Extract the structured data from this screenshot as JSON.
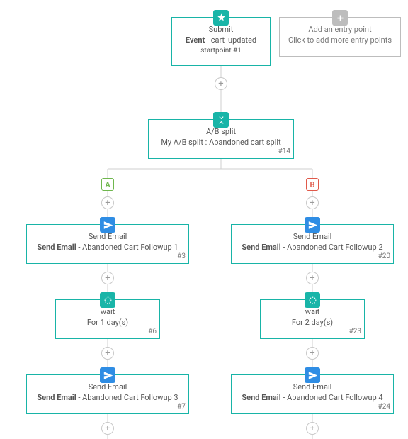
{
  "entry": {
    "title": "Submit",
    "sub_bold": "Event",
    "sub_rest": " - cart_updated",
    "startpoint": "startpoint #1"
  },
  "entry_add": {
    "title": "Add an entry point",
    "sub": "Click to add more entry points"
  },
  "ab_split": {
    "title": "A/B split",
    "sub": "My A/B split : Abandoned cart split",
    "id": "#14"
  },
  "branch_a_label": "A",
  "branch_b_label": "B",
  "a_email1": {
    "title": "Send Email",
    "sub_bold": "Send Email",
    "sub_rest": " - Abandoned Cart Followup 1",
    "id": "#3"
  },
  "a_wait": {
    "title": "wait",
    "sub": "For 1 day(s)",
    "id": "#6"
  },
  "a_email2": {
    "title": "Send Email",
    "sub_bold": "Send Email",
    "sub_rest": " - Abandoned Cart Followup 3",
    "id": "#7"
  },
  "b_email1": {
    "title": "Send Email",
    "sub_bold": "Send Email",
    "sub_rest": " - Abandoned Cart Followup 2",
    "id": "#20"
  },
  "b_wait": {
    "title": "wait",
    "sub": "For 2 day(s)",
    "id": "#23"
  },
  "b_email2": {
    "title": "Send Email",
    "sub_bold": "Send Email",
    "sub_rest": " - Abandoned Cart Followup 4",
    "id": "#24"
  }
}
